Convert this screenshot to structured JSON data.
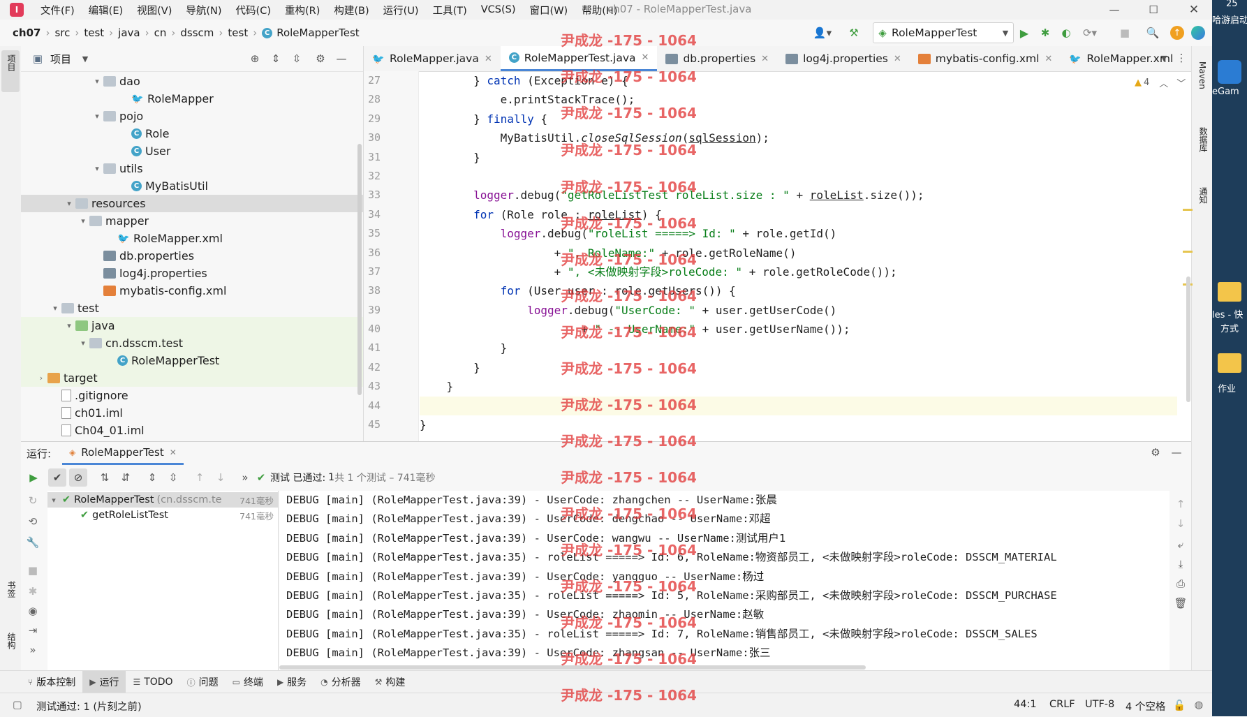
{
  "menu": [
    "文件(F)",
    "编辑(E)",
    "视图(V)",
    "导航(N)",
    "代码(C)",
    "重构(R)",
    "构建(B)",
    "运行(U)",
    "工具(T)",
    "VCS(S)",
    "窗口(W)",
    "帮助(H)"
  ],
  "window_title": "ch07 - RoleMapperTest.java",
  "breadcrumb": [
    "ch07",
    "src",
    "test",
    "java",
    "cn",
    "dsscm",
    "test",
    "RoleMapperTest"
  ],
  "run_config": "RoleMapperTest",
  "left_stripe": {
    "project": "项目",
    "bookmarks": "书签",
    "structure": "结构"
  },
  "right_stripe": {
    "maven": "Maven",
    "database": "数据库",
    "notifications": "通知"
  },
  "project_panel": {
    "title": "项目",
    "tree": [
      {
        "label": "dao",
        "indent": 5,
        "icon": "folder",
        "chevron": "down"
      },
      {
        "label": "RoleMapper",
        "indent": 7,
        "icon": "mybatis"
      },
      {
        "label": "pojo",
        "indent": 5,
        "icon": "folder",
        "chevron": "down"
      },
      {
        "label": "Role",
        "indent": 7,
        "icon": "class"
      },
      {
        "label": "User",
        "indent": 7,
        "icon": "class"
      },
      {
        "label": "utils",
        "indent": 5,
        "icon": "folder",
        "chevron": "down"
      },
      {
        "label": "MyBatisUtil",
        "indent": 7,
        "icon": "class"
      },
      {
        "label": "resources",
        "indent": 3,
        "icon": "resfolder",
        "chevron": "down",
        "selected": true
      },
      {
        "label": "mapper",
        "indent": 4,
        "icon": "folder",
        "chevron": "down"
      },
      {
        "label": "RoleMapper.xml",
        "indent": 6,
        "icon": "mybatis"
      },
      {
        "label": "db.properties",
        "indent": 5,
        "icon": "props"
      },
      {
        "label": "log4j.properties",
        "indent": 5,
        "icon": "props"
      },
      {
        "label": "mybatis-config.xml",
        "indent": 5,
        "icon": "xml"
      },
      {
        "label": "test",
        "indent": 2,
        "icon": "folder",
        "chevron": "down"
      },
      {
        "label": "java",
        "indent": 3,
        "icon": "srcfolder",
        "chevron": "down",
        "highlight": true
      },
      {
        "label": "cn.dsscm.test",
        "indent": 4,
        "icon": "folder",
        "chevron": "down",
        "highlight": true
      },
      {
        "label": "RoleMapperTest",
        "indent": 6,
        "icon": "class",
        "highlight": true
      },
      {
        "label": "target",
        "indent": 1,
        "icon": "orangefolder",
        "chevron": "right",
        "highlight": true
      },
      {
        "label": ".gitignore",
        "indent": 2,
        "icon": "file"
      },
      {
        "label": "ch01.iml",
        "indent": 2,
        "icon": "file"
      },
      {
        "label": "Ch04_01.iml",
        "indent": 2,
        "icon": "file"
      }
    ]
  },
  "editor_tabs": [
    {
      "label": "RoleMapper.java",
      "icon": "mybatis",
      "active": false
    },
    {
      "label": "RoleMapperTest.java",
      "icon": "class",
      "active": true
    },
    {
      "label": "db.properties",
      "icon": "props",
      "active": false
    },
    {
      "label": "log4j.properties",
      "icon": "props",
      "active": false
    },
    {
      "label": "mybatis-config.xml",
      "icon": "xml",
      "active": false
    },
    {
      "label": "RoleMapper.xml",
      "icon": "mybatis",
      "active": false
    }
  ],
  "warnings_count": "4",
  "line_numbers": [
    "27",
    "28",
    "29",
    "30",
    "31",
    "32",
    "33",
    "34",
    "35",
    "36",
    "37",
    "38",
    "39",
    "40",
    "41",
    "42",
    "43",
    "44",
    "45"
  ],
  "code_lines": [
    [
      [
        "t",
        "        } "
      ],
      [
        "kw",
        "catch"
      ],
      [
        "t",
        " (Exception e) {"
      ]
    ],
    [
      [
        "t",
        "            e."
      ],
      [
        "t",
        "printStackTrace"
      ],
      [
        "t",
        "();"
      ]
    ],
    [
      [
        "t",
        "        } "
      ],
      [
        "kw",
        "finally"
      ],
      [
        "t",
        " {"
      ]
    ],
    [
      [
        "t",
        "            MyBatisUtil."
      ],
      [
        "it",
        "closeSqlSession"
      ],
      [
        "t",
        "("
      ],
      [
        "u",
        "sqlSession"
      ],
      [
        "t",
        ");"
      ]
    ],
    [
      [
        "t",
        "        }"
      ]
    ],
    [
      [
        "t",
        ""
      ]
    ],
    [
      [
        "t",
        "        "
      ],
      [
        "fld",
        "logger"
      ],
      [
        "t",
        ".debug("
      ],
      [
        "str",
        "\"getRoleListTest roleList.size : \""
      ],
      [
        "t",
        " + "
      ],
      [
        "u",
        "roleList"
      ],
      [
        "t",
        ".size());"
      ]
    ],
    [
      [
        "t",
        "        "
      ],
      [
        "kw",
        "for"
      ],
      [
        "t",
        " (Role role : "
      ],
      [
        "u",
        "roleList"
      ],
      [
        "t",
        ") {"
      ]
    ],
    [
      [
        "t",
        "            "
      ],
      [
        "fld",
        "logger"
      ],
      [
        "t",
        ".debug("
      ],
      [
        "str",
        "\"roleList =====> Id: \""
      ],
      [
        "t",
        " + role.getId()"
      ]
    ],
    [
      [
        "t",
        "                    + "
      ],
      [
        "str",
        "\", RoleName:\""
      ],
      [
        "t",
        " + role.getRoleName()"
      ]
    ],
    [
      [
        "t",
        "                    + "
      ],
      [
        "str",
        "\", <未做映射字段>roleCode: \""
      ],
      [
        "t",
        " + role.getRoleCode());"
      ]
    ],
    [
      [
        "t",
        "            "
      ],
      [
        "kw",
        "for"
      ],
      [
        "t",
        " (User user : role.getUsers()) {"
      ]
    ],
    [
      [
        "t",
        "                "
      ],
      [
        "fld",
        "logger"
      ],
      [
        "t",
        ".debug("
      ],
      [
        "str",
        "\"UserCode: \""
      ],
      [
        "t",
        " + user.getUserCode()"
      ]
    ],
    [
      [
        "t",
        "                        + "
      ],
      [
        "str",
        "\" -- UserName:\""
      ],
      [
        "t",
        " + user.getUserName());"
      ]
    ],
    [
      [
        "t",
        "            }"
      ]
    ],
    [
      [
        "t",
        "        }"
      ]
    ],
    [
      [
        "t",
        "    }"
      ]
    ],
    [
      [
        "t",
        ""
      ]
    ],
    [
      [
        "t",
        "}"
      ]
    ]
  ],
  "run_panel": {
    "label": "运行:",
    "tab": "RoleMapperTest",
    "status_prefix": "测试 已通过:",
    "status_count": "1",
    "status_suffix": "共 1 个测试 – 741毫秒",
    "tests": [
      {
        "name": "RoleMapperTest",
        "detail": "(cn.dsscm.te",
        "time": "741毫秒"
      },
      {
        "name": "getRoleListTest",
        "detail": "",
        "time": "741毫秒"
      }
    ],
    "console": [
      "DEBUG [main] (RoleMapperTest.java:39) - UserCode: zhangchen -- UserName:张晨",
      "DEBUG [main] (RoleMapperTest.java:39) - UserCode: dengchao -- UserName:邓超",
      "DEBUG [main] (RoleMapperTest.java:39) - UserCode: wangwu -- UserName:测试用户1",
      "DEBUG [main] (RoleMapperTest.java:35) - roleList =====> Id: 6, RoleName:物资部员工, <未做映射字段>roleCode: DSSCM_MATERIAL",
      "DEBUG [main] (RoleMapperTest.java:39) - UserCode: yangguo -- UserName:杨过",
      "DEBUG [main] (RoleMapperTest.java:35) - roleList =====> Id: 5, RoleName:采购部员工, <未做映射字段>roleCode: DSSCM_PURCHASE",
      "DEBUG [main] (RoleMapperTest.java:39) - UserCode: zhaomin -- UserName:赵敏",
      "DEBUG [main] (RoleMapperTest.java:35) - roleList =====> Id: 7, RoleName:销售部员工, <未做映射字段>roleCode: DSSCM_SALES",
      "DEBUG [main] (RoleMapperTest.java:39) - UserCode: zhangsan -- UserName:张三"
    ]
  },
  "tool_windows": [
    "版本控制",
    "运行",
    "TODO",
    "问题",
    "终端",
    "服务",
    "分析器",
    "构建"
  ],
  "status_bar": {
    "message": "测试通过: 1 (片刻之前)",
    "position": "44:1",
    "line_sep": "CRLF",
    "encoding": "UTF-8",
    "indent": "4 个空格"
  },
  "desktop": {
    "top_label": "25",
    "item1": "哈游启动",
    "item2": "eGam",
    "item3_line1": "les - 快",
    "item3_line2": "方式",
    "item4": "作业"
  },
  "watermark": "尹成龙 -175 - 1064",
  "colors": {
    "keyword": "#0033b3",
    "string": "#067d17",
    "field": "#871094",
    "pass": "#3f9d3f",
    "watermark": "#e23b3b"
  }
}
